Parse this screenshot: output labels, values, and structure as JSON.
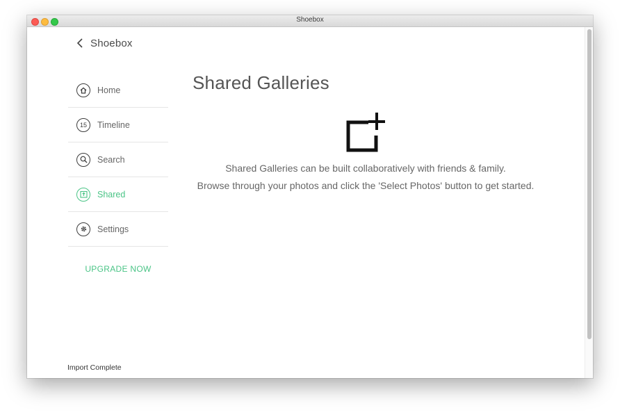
{
  "window": {
    "title": "Shoebox"
  },
  "back": {
    "label": "Shoebox"
  },
  "nav": {
    "items": [
      {
        "label": "Home",
        "icon": "home-icon"
      },
      {
        "label": "Timeline",
        "icon": "timeline-icon",
        "icon_text": "15"
      },
      {
        "label": "Search",
        "icon": "search-icon"
      },
      {
        "label": "Shared",
        "icon": "shared-icon",
        "active": true
      },
      {
        "label": "Settings",
        "icon": "gear-icon"
      }
    ],
    "upgrade_label": "UPGRADE NOW"
  },
  "main": {
    "title": "Shared Galleries",
    "icon": "add-gallery-icon",
    "message_1": "Shared Galleries can be built collaboratively with friends & family.",
    "message_2": "Browse through your photos and click the 'Select Photos' button to get started."
  },
  "status": {
    "text": "Import Complete"
  },
  "colors": {
    "accent": "#4ac486",
    "text": "#666666",
    "title": "#555555"
  }
}
